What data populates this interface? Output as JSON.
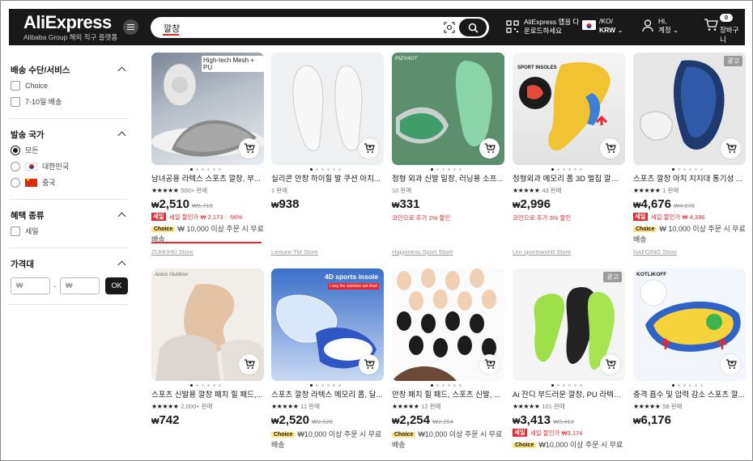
{
  "header": {
    "logo": "AliExpress",
    "logo_sub": "Alibaba Group 해외 직구 플랫폼",
    "search_value": "깔창",
    "app_line1": "AliExpress 앱을 다",
    "app_line2": "운로드하세요",
    "lang_line1": "/KO/",
    "lang_line2": "KRW",
    "user_line1": "Hi,",
    "user_line2": "계정",
    "cart_count": "0",
    "cart_label": "장바구니"
  },
  "sidebar": {
    "shipping": {
      "title": "배송 수단/서비스",
      "options": [
        "Choice",
        "7-10일 배송"
      ]
    },
    "country": {
      "title": "발송 국가",
      "options": [
        "모든",
        "대한민국",
        "중국"
      ]
    },
    "benefit": {
      "title": "혜택 종류",
      "options": [
        "세일"
      ]
    },
    "price": {
      "title": "가격대",
      "min_placeholder": "₩",
      "max_placeholder": "₩",
      "ok": "OK"
    }
  },
  "products": [
    {
      "title": "남녀공용 라텍스 스포츠 깔창, 부...",
      "sold": "500+ 판매",
      "price": "2,510",
      "old": "₩5,719",
      "sale": "세일",
      "sale_text": "세일 할인가 ₩ 2,173 · -56%",
      "choice": "Choice",
      "choice_text": "₩ 10,000 이상 주문 시 무료 배송",
      "store": "ZUHUHU Store",
      "ad": ""
    },
    {
      "title": "실리콘 안창 하이힐 발 쿠션 아치...",
      "sold": "1 판매",
      "price": "938",
      "old": "",
      "store": "Leisure-TM Store",
      "ad": ""
    },
    {
      "title": "정형 외과 신발 밑창, 러닝용 소프...",
      "sold": "10 판매",
      "price": "331",
      "old": "",
      "coin": "코인으로 추가 2% 할인",
      "store": "Happiness Sport Store",
      "ad": ""
    },
    {
      "title": "정형외과 메모리 폼 3D 벌집 깔창,...",
      "sold": "43 판매",
      "price": "2,996",
      "old": "",
      "coin": "코인으로 추가 3% 할인",
      "store": "Um sportsworld Store",
      "ad": ""
    },
    {
      "title": "스포츠 깔창 아치 지지대 통기성 ...",
      "sold": "1 판매",
      "price": "4,676",
      "old": "₩4,676",
      "sale": "세일",
      "sale_text": "세일 할인가 ₩ 4,396",
      "choice": "Choice",
      "choice_text": "₩ 10,000 이상 주문 시 무료 배송",
      "store": "NAFOING Store",
      "ad": "광고"
    },
    {
      "title": "스포츠 신발용 깔창 패치 힐 패드,...",
      "sold": "2,000+ 판매",
      "price": "742",
      "old": "",
      "ad": ""
    },
    {
      "title": "스포츠 깔창 라텍스 메모리 폼, 달...",
      "sold": "11 판매",
      "price": "2,520",
      "old": "₩2,520",
      "choice": "Choice",
      "choice_text": "₩10,000 이상 주문 시 무료 배송",
      "ad": ""
    },
    {
      "title": "안창 패치 힐 패드, 스포츠 신발, ...",
      "sold": "12 판매",
      "price": "2,254",
      "old": "₩2,254",
      "choice": "Choice",
      "choice_text": "₩10,000 이상 주문 시 무료 배송",
      "ad": ""
    },
    {
      "title": "Ai 잔디 부드러운 깔창, PU 라텍스...",
      "sold": "101 판매",
      "price": "3,413",
      "old": "₩3,413",
      "sale": "세일",
      "sale_text": "세일 할인가 ₩3,174",
      "choice": "Choice",
      "choice_text": "₩10,000 이상 주문 시 무료",
      "ad": "광고"
    },
    {
      "title": "충격 흡수 및 압력 감소 스포츠 깔...",
      "sold": "58 판매",
      "price": "6,176",
      "old": "",
      "ad": ""
    }
  ],
  "currency": "₩",
  "stars": "★★★★★",
  "image_texts": {
    "p1": "High-tech Mesh + PU",
    "p7": "4D sports insole",
    "p7_sub": "Long the violetion out fired",
    "p10": "KOTLIKOFF",
    "p6": "Aoius Outdoor",
    "p3": "PIZYAOT"
  },
  "colors": {
    "accent": "#e8272e",
    "choice": "#fde37c",
    "header_bg": "#191919"
  }
}
